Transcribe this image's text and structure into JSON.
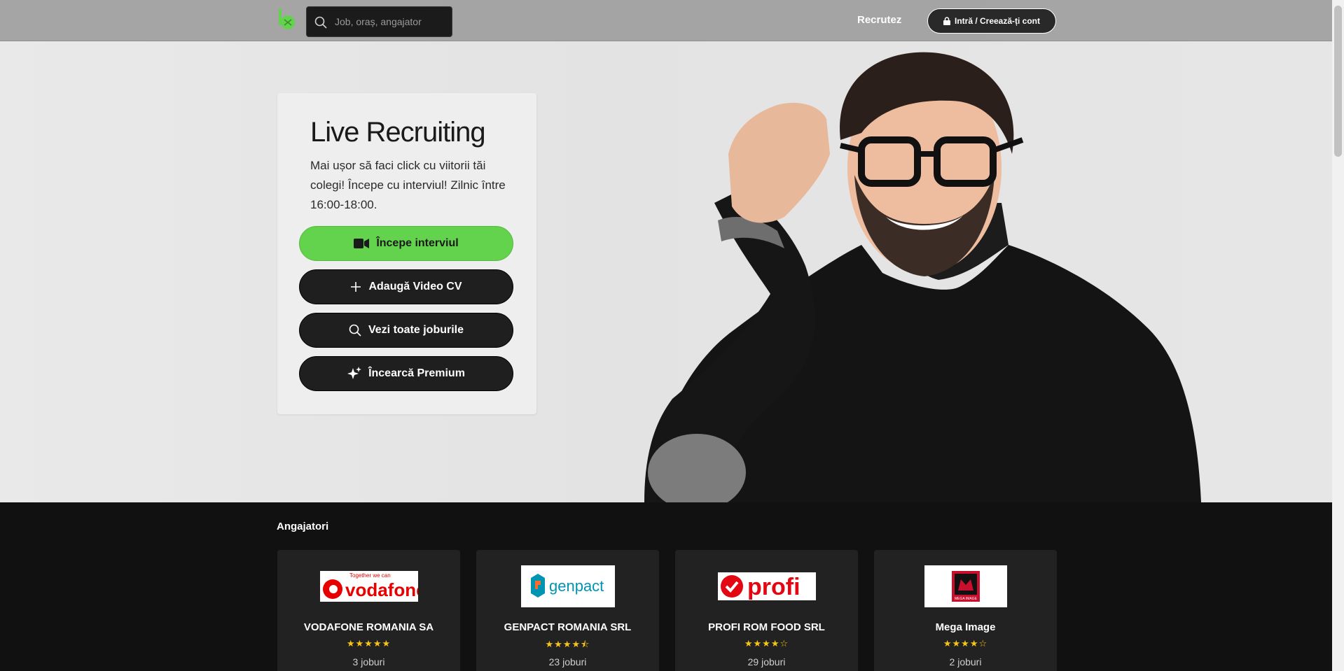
{
  "header": {
    "search_placeholder": "Job, oraș, angajator",
    "nav_recruit": "Recrutez",
    "login_label": "Intră / Creează-ți cont"
  },
  "hero": {
    "title": "Live Recruiting",
    "subtitle": "Mai ușor să faci click cu viitorii tăi colegi! Începe cu interviul! Zilnic între 16:00-18:00.",
    "buttons": [
      {
        "label": "Începe interviul",
        "icon": "video-camera-icon"
      },
      {
        "label": "Adaugă Video CV",
        "icon": "plus-icon"
      },
      {
        "label": "Vezi toate joburile",
        "icon": "search-icon"
      },
      {
        "label": "Încearcă Premium",
        "icon": "sparkle-icon"
      }
    ]
  },
  "employers": {
    "heading": "Angajatori",
    "items": [
      {
        "name": "VODAFONE ROMANIA SA",
        "stars": "★★★★★",
        "rating": 5,
        "jobs": "3 joburi",
        "logo_text": "vodafone",
        "logo_tagline": "Together we can"
      },
      {
        "name": "GENPACT ROMANIA SRL",
        "stars": "★★★★⯪",
        "rating": 4.5,
        "jobs": "23 joburi",
        "logo_text": "genpact"
      },
      {
        "name": "PROFI ROM FOOD SRL",
        "stars": "★★★★☆",
        "rating": 4,
        "jobs": "29 joburi",
        "logo_text": "profi"
      },
      {
        "name": "Mega Image",
        "stars": "★★★★☆",
        "rating": 4,
        "jobs": "2 joburi",
        "logo_text": "MEGA IMAGE"
      }
    ]
  },
  "colors": {
    "accent_green": "#63d24d",
    "dark": "#111111"
  }
}
